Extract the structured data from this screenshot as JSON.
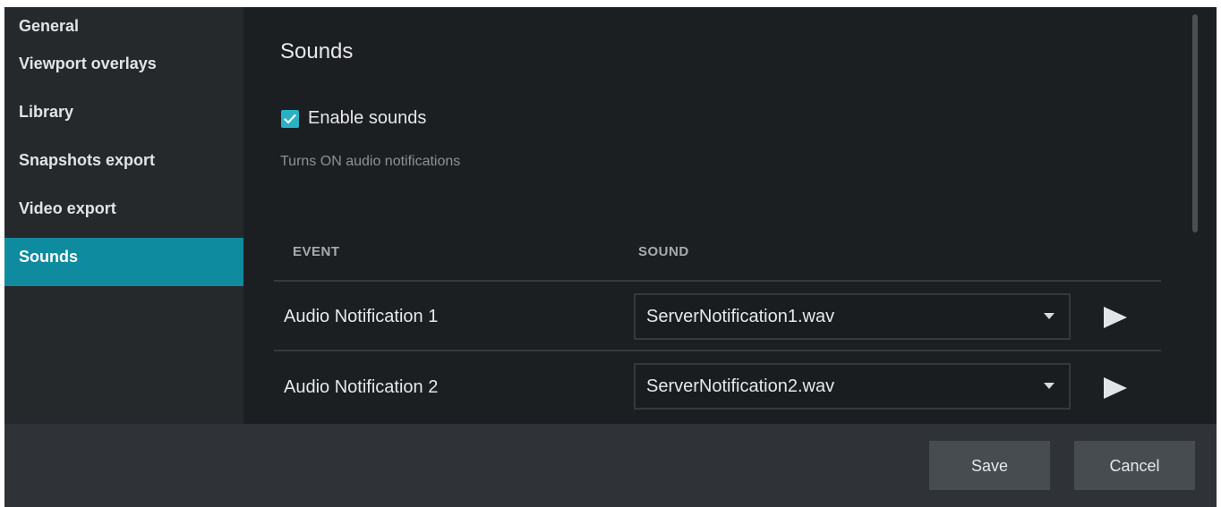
{
  "sidebar": {
    "items": [
      {
        "label": "General"
      },
      {
        "label": "Viewport overlays"
      },
      {
        "label": "Library"
      },
      {
        "label": "Snapshots export"
      },
      {
        "label": "Video export"
      },
      {
        "label": "Sounds"
      }
    ],
    "active_index": 5
  },
  "main": {
    "title": "Sounds",
    "enable_sounds": {
      "label": "Enable sounds",
      "checked": true
    },
    "hint": "Turns ON audio notifications",
    "columns": {
      "event": "EVENT",
      "sound": "SOUND"
    },
    "rows": [
      {
        "event": "Audio Notification 1",
        "sound": "ServerNotification1.wav"
      },
      {
        "event": "Audio Notification 2",
        "sound": "ServerNotification2.wav"
      }
    ]
  },
  "footer": {
    "save_label": "Save",
    "cancel_label": "Cancel"
  },
  "colors": {
    "accent": "#0e8b9f",
    "checkbox": "#2ab0c4",
    "background": "#1c1f22",
    "sidebar": "#25292c",
    "footer": "#2f3337",
    "button": "#474c50"
  },
  "icons": [
    "check-icon",
    "dropdown-arrow-icon",
    "play-icon"
  ]
}
